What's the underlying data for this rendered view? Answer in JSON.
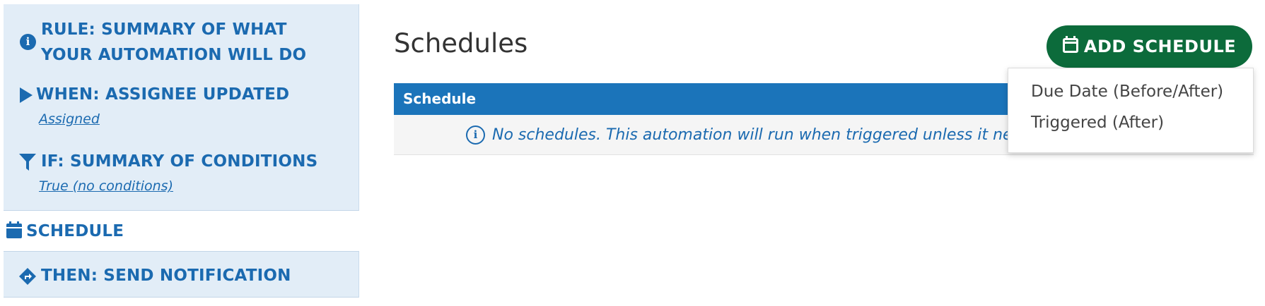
{
  "sidebar": {
    "rule": {
      "title_line1": "RULE: SUMMARY OF WHAT",
      "title_line2": "YOUR AUTOMATION WILL DO",
      "icon": "info-circle-icon"
    },
    "when": {
      "title": "WHEN: ASSIGNEE UPDATED",
      "subtitle": "Assigned",
      "icon": "play-icon"
    },
    "if": {
      "title": "IF: SUMMARY OF CONDITIONS",
      "subtitle": "True (no conditions)",
      "icon": "filter-icon"
    },
    "schedule": {
      "title": "SCHEDULE",
      "icon": "calendar-icon"
    },
    "then": {
      "title": "THEN: SEND NOTIFICATION",
      "icon": "directions-icon"
    }
  },
  "main": {
    "title": "Schedules",
    "add_button": {
      "label": "ADD SCHEDULE",
      "icon": "calendar-outline-icon"
    },
    "table": {
      "header": "Schedule",
      "empty_message": "No schedules. This automation will run when triggered unless it nee"
    },
    "dropdown": {
      "items": [
        "Due Date (Before/After)",
        "Triggered (After)"
      ]
    }
  },
  "colors": {
    "primary_blue": "#1b6ab0",
    "header_blue": "#1b74ba",
    "button_green": "#0c6b3b",
    "sidebar_bg": "#e2edf7"
  }
}
